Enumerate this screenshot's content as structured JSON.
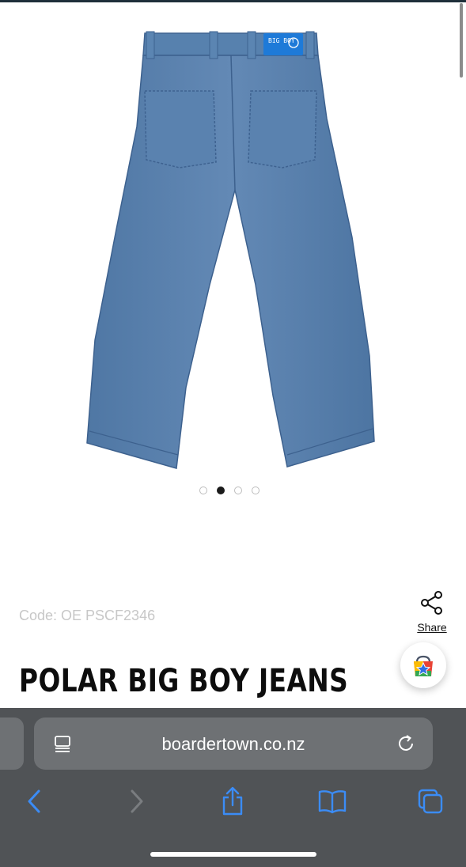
{
  "product": {
    "image_label": "BIG BOY",
    "code": "Code: OE PSCF2346",
    "title": "POLAR BIG BOY JEANS",
    "share_label": "Share",
    "gallery": {
      "count": 4,
      "active_index": 1
    }
  },
  "browser": {
    "url": "boardertown.co.nz"
  },
  "icons": {
    "share": "share-icon",
    "shop": "shopping-bag-star-icon",
    "tab_overview": "reader-icon",
    "reload": "reload-icon",
    "back": "back-chevron-icon",
    "forward": "forward-chevron-icon",
    "share_sheet": "share-sheet-icon",
    "bookmarks": "bookmarks-icon",
    "tabs": "tabs-icon"
  },
  "colors": {
    "accent": "#3b8cf6",
    "denim": "#5b81ad",
    "browser_bar": "#505356"
  }
}
